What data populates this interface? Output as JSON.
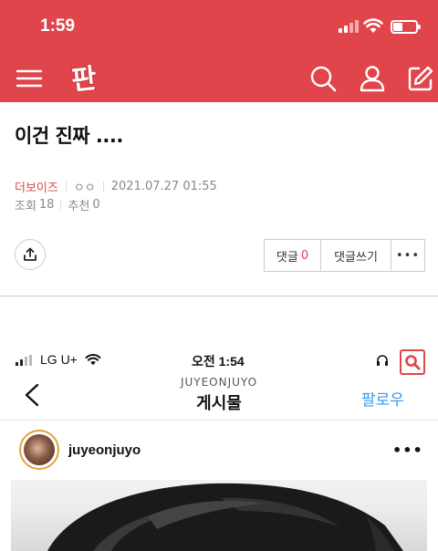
{
  "status_bar": {
    "time": "1:59"
  },
  "nav": {
    "logo_text": "판",
    "icons": [
      "menu-icon",
      "search-icon",
      "user-icon",
      "write-icon"
    ],
    "color": "#e0454b"
  },
  "post": {
    "title": "이건 진짜 ....",
    "author": "더보이즈",
    "category": "ㅇㅇ",
    "datetime": "2021.07.27 01:55",
    "views_label": "조회",
    "views": "18",
    "recommend_label": "추천",
    "recommend": "0"
  },
  "actions": {
    "comment_label": "댓글",
    "comment_count": "0",
    "write_comment_label": "댓글쓰기",
    "more_label": "•••"
  },
  "embedded_screenshot": {
    "carrier": "LG U+",
    "time": "오전 1:54",
    "account_handle": "JUYEONJUYO",
    "header_title": "게시물",
    "follow_label": "팔로우",
    "username": "juyeonjuyo",
    "more_label": "•••"
  }
}
